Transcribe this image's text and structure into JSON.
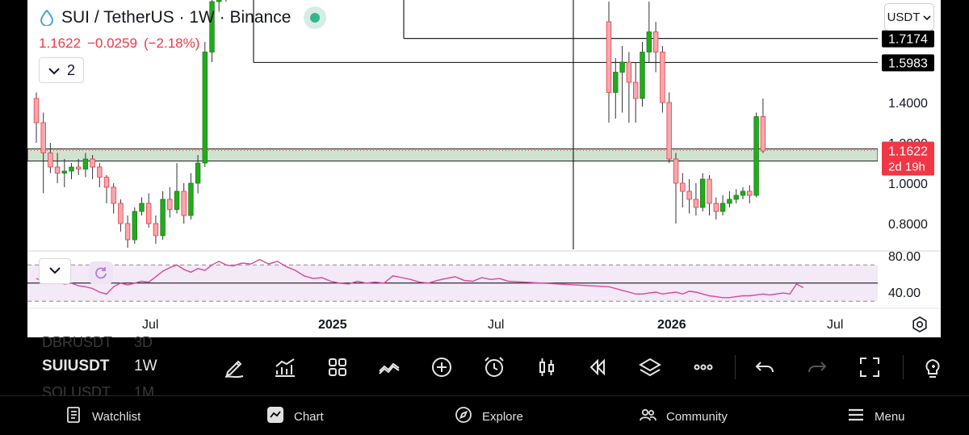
{
  "header": {
    "symbol_title": "SUI / TetherUS · 1W · Binance",
    "price": "1.1622",
    "change": "−0.0259",
    "change_pct": "(−2.18%)",
    "collapse_count": "2",
    "currency": "USDT"
  },
  "colors": {
    "up": "#22ab1e",
    "down": "#f4a9ad",
    "down_border": "#f23645",
    "zone": "#cfe3d0",
    "rsi_line": "#d8479b",
    "rsi_band": "#f3e9f7",
    "price_badge": "#f23645"
  },
  "price_axis": {
    "ticks": [
      "1.4000",
      "1.2000",
      "1.0000",
      "0.8000"
    ],
    "tags": [
      {
        "label": "1.7174",
        "price": 1.7174
      },
      {
        "label": "1.5983",
        "price": 1.5983
      }
    ],
    "current": {
      "label": "1.1622",
      "countdown": "2d 19h",
      "price": 1.1622
    }
  },
  "rsi_axis": {
    "ticks": [
      "80.00",
      "40.00"
    ]
  },
  "time_axis": {
    "labels": [
      "Jul",
      "2025",
      "Jul",
      "2026",
      "Jul"
    ]
  },
  "icons": {
    "symbol_icon": "sui-drop-icon",
    "live": "live-status-icon",
    "settings": "settings-gear-icon"
  },
  "watchlist": [
    {
      "symbol": "DBRUSDT",
      "tf": "3D"
    },
    {
      "symbol": "SUIUSDT",
      "tf": "1W"
    },
    {
      "symbol": "SOLUSDT",
      "tf": "1M"
    }
  ],
  "bottom_nav": [
    {
      "label": "Watchlist",
      "icon": "watchlist-icon"
    },
    {
      "label": "Chart",
      "icon": "chart-icon"
    },
    {
      "label": "Explore",
      "icon": "compass-icon"
    },
    {
      "label": "Community",
      "icon": "community-icon"
    },
    {
      "label": "Menu",
      "icon": "menu-icon"
    }
  ],
  "chart_data": {
    "type": "candlestick",
    "symbol": "SUI / TetherUS",
    "interval": "1W",
    "exchange": "Binance",
    "x_range": [
      "2024-05",
      "2026-07"
    ],
    "y_range": [
      0.72,
      1.95
    ],
    "support_zone": [
      1.11,
      1.17
    ],
    "horizontal_levels": [
      1.7174,
      1.5983
    ],
    "candles_2024": [
      [
        1.42,
        1.3,
        1.45,
        1.2
      ],
      [
        1.3,
        1.15,
        1.35,
        0.95
      ],
      [
        1.15,
        1.08,
        1.2,
        1.05
      ],
      [
        1.08,
        1.05,
        1.15,
        1.0
      ],
      [
        1.05,
        1.06,
        1.12,
        0.98
      ],
      [
        1.06,
        1.08,
        1.1,
        1.02
      ],
      [
        1.08,
        1.07,
        1.12,
        1.04
      ],
      [
        1.07,
        1.12,
        1.15,
        1.03
      ],
      [
        1.12,
        1.08,
        1.14,
        1.02
      ],
      [
        1.08,
        1.03,
        1.1,
        0.98
      ],
      [
        1.03,
        0.98,
        1.04,
        0.9
      ],
      [
        0.98,
        0.9,
        1.0,
        0.85
      ],
      [
        0.9,
        0.8,
        0.92,
        0.76
      ],
      [
        0.8,
        0.72,
        0.84,
        0.68
      ],
      [
        0.72,
        0.86,
        0.88,
        0.7
      ],
      [
        0.86,
        0.9,
        0.93,
        0.84
      ],
      [
        0.9,
        0.8,
        0.95,
        0.78
      ],
      [
        0.8,
        0.74,
        0.84,
        0.7
      ],
      [
        0.74,
        0.92,
        0.96,
        0.72
      ],
      [
        0.92,
        0.87,
        0.98,
        0.83
      ],
      [
        0.87,
        0.96,
        1.1,
        0.85
      ],
      [
        0.96,
        0.84,
        1.0,
        0.8
      ],
      [
        0.84,
        1.0,
        1.05,
        0.82
      ],
      [
        1.0,
        1.1,
        1.14,
        0.95
      ],
      [
        1.1,
        1.65,
        1.7,
        1.08
      ],
      [
        1.65,
        1.9,
        1.95,
        1.6
      ],
      [
        1.9,
        2.0,
        2.1,
        1.85
      ],
      [
        2.0,
        2.05,
        2.15,
        1.9
      ]
    ],
    "candles_2026": [
      [
        1.8,
        1.45,
        1.9,
        1.3
      ],
      [
        1.45,
        1.55,
        1.62,
        1.32
      ],
      [
        1.55,
        1.6,
        1.68,
        1.35
      ],
      [
        1.6,
        1.5,
        1.65,
        1.3
      ],
      [
        1.5,
        1.42,
        1.6,
        1.3
      ],
      [
        1.42,
        1.65,
        1.7,
        1.38
      ],
      [
        1.65,
        1.75,
        1.9,
        1.6
      ],
      [
        1.75,
        1.65,
        1.8,
        1.55
      ],
      [
        1.65,
        1.4,
        1.68,
        1.35
      ],
      [
        1.4,
        1.12,
        1.45,
        1.1
      ],
      [
        1.12,
        1.0,
        1.15,
        0.8
      ],
      [
        1.0,
        0.96,
        1.05,
        0.88
      ],
      [
        0.96,
        0.92,
        1.02,
        0.85
      ],
      [
        0.92,
        0.88,
        1.0,
        0.84
      ],
      [
        0.88,
        1.02,
        1.05,
        0.86
      ],
      [
        1.02,
        0.9,
        1.04,
        0.84
      ],
      [
        0.9,
        0.86,
        0.93,
        0.82
      ],
      [
        0.86,
        0.9,
        0.94,
        0.84
      ],
      [
        0.9,
        0.92,
        0.96,
        0.88
      ],
      [
        0.92,
        0.94,
        0.97,
        0.9
      ],
      [
        0.94,
        0.96,
        0.98,
        0.92
      ],
      [
        0.96,
        0.94,
        0.99,
        0.9
      ],
      [
        0.94,
        1.33,
        1.35,
        0.93
      ],
      [
        1.33,
        1.16,
        1.42,
        1.15
      ]
    ],
    "rsi_levels": [
      70,
      30
    ],
    "rsi_2024": [
      55,
      52,
      50,
      51,
      49,
      50,
      47,
      46,
      44,
      40,
      38,
      46,
      50,
      48,
      50,
      52,
      51,
      57,
      63,
      67,
      70,
      65,
      62,
      66,
      64,
      70,
      74,
      70
    ],
    "rsi_2025": [
      69,
      72,
      71,
      76,
      71,
      74,
      68,
      64,
      58,
      55,
      56,
      52,
      50,
      49,
      52,
      50,
      51,
      50,
      58,
      56,
      54,
      51,
      50,
      53,
      55,
      57,
      53,
      52,
      56,
      54,
      55,
      52
    ],
    "rsi_2026": [
      46,
      44,
      42,
      40,
      38,
      38,
      39,
      40,
      38,
      39,
      40,
      38,
      41,
      40,
      38,
      36,
      35,
      34,
      34,
      35,
      36,
      36,
      37,
      38,
      37,
      38,
      39,
      38,
      49,
      45
    ]
  }
}
